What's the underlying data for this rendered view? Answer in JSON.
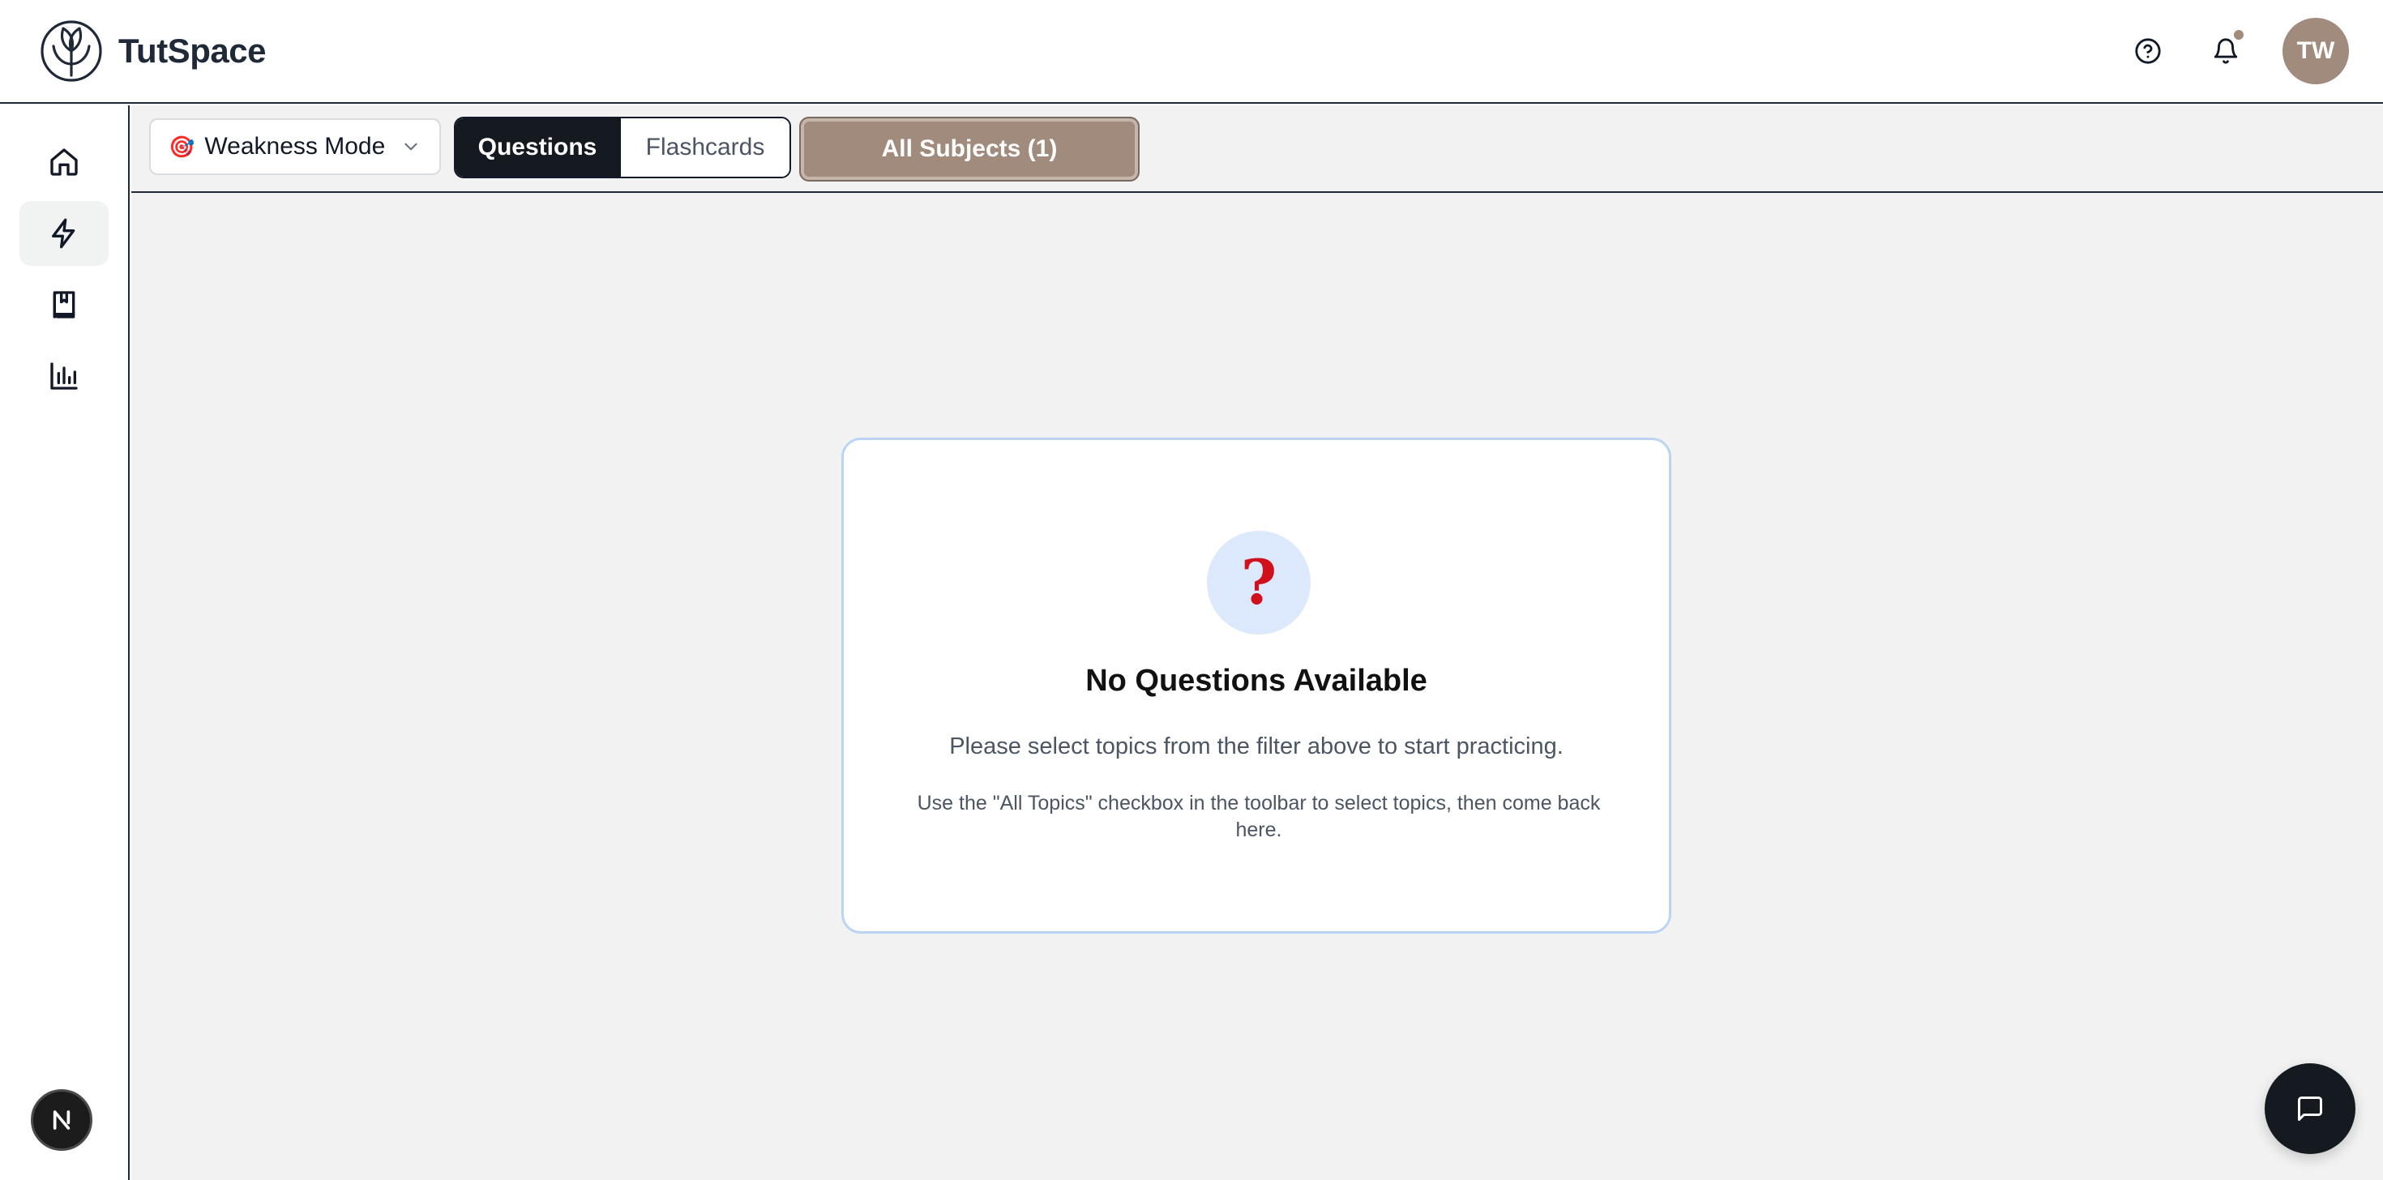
{
  "header": {
    "brand": "TutSpace",
    "avatar_initials": "TW"
  },
  "sidebar": {
    "items": [
      {
        "name": "home",
        "icon": "home-icon",
        "active": false
      },
      {
        "name": "practice",
        "icon": "lightning-icon",
        "active": true
      },
      {
        "name": "library",
        "icon": "bookmark-book-icon",
        "active": false
      },
      {
        "name": "analytics",
        "icon": "bar-chart-icon",
        "active": false
      }
    ]
  },
  "toolbar": {
    "mode_emoji": "🎯",
    "mode_label": "Weakness Mode",
    "segments": [
      "Questions",
      "Flashcards"
    ],
    "active_segment": "Questions",
    "subjects_label": "All Subjects (1)"
  },
  "empty_state": {
    "glyph": "?",
    "title": "No Questions Available",
    "subtitle": "Please select topics from the filter above to start practicing.",
    "hint": "Use the \"All Topics\" checkbox in the toolbar to select topics, then come back here."
  },
  "colors": {
    "accent_brown": "#a08b7d",
    "dark": "#141a1f",
    "card_border": "#bcd4f3",
    "question_red": "#d0101a"
  }
}
